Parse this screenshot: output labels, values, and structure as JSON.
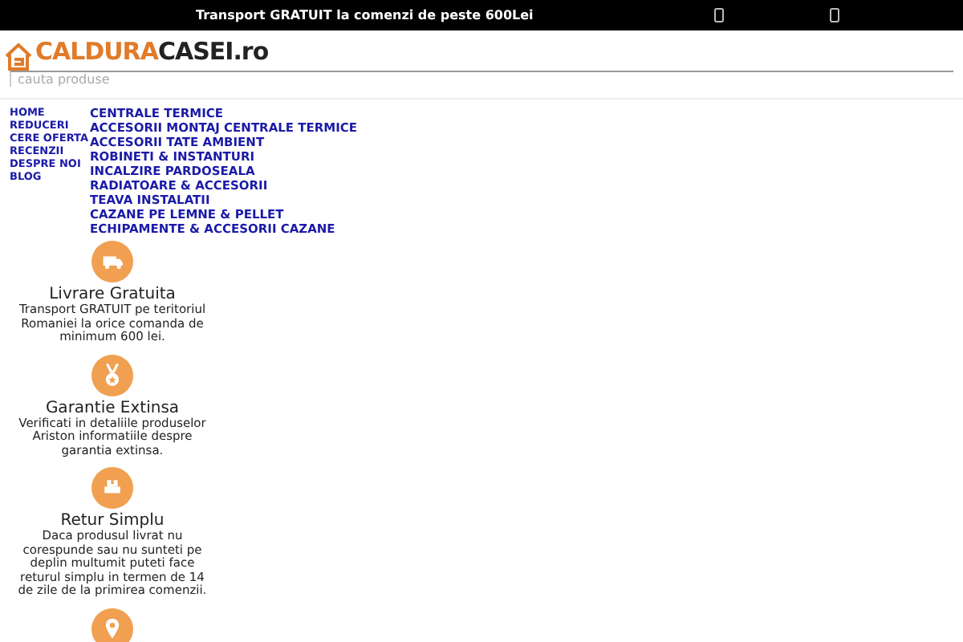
{
  "top_bar": {
    "promo": "Transport GRATUIT la comenzi de peste 600Lei"
  },
  "logo": {
    "part_1": "CALDURA",
    "part_2": "CASEI.ro"
  },
  "search": {
    "placeholder": "cauta produse"
  },
  "nav_links": [
    "HOME",
    "REDUCERI",
    "CERE OFERTA",
    "RECENZII",
    "DESPRE NOI",
    "BLOG"
  ],
  "categories": [
    "CENTRALE TERMICE",
    "ACCESORII MONTAJ CENTRALE TERMICE",
    "ACCESORII TATE AMBIENT",
    "ROBINETI & INSTANTURI",
    "INCALZIRE PARDOSEALA",
    "RADIATOARE & ACCESORII",
    "TEAVA INSTALATII",
    "CAZANE PE LEMNE & PELLET",
    "ECHIPAMENTE & ACCESORII CAZANE"
  ],
  "features": [
    {
      "kind": "truck",
      "title": "Livrare Gratuita",
      "text": "Transport GRATUIT pe teritoriul Romaniei la orice comanda de minimum 600 lei."
    },
    {
      "kind": "medal",
      "title": "Garantie Extinsa",
      "text": "Verificati in detaliile produselor Ariston informatiile despre garantia extinsa."
    },
    {
      "kind": "box",
      "title": "Retur Simplu",
      "text": "Daca produsul livrat nu corespunde sau nu sunteti pe deplin multumit puteti face returul simplu in termen de 14 de zile de la primirea comenzii."
    },
    {
      "kind": "pin"
    }
  ]
}
